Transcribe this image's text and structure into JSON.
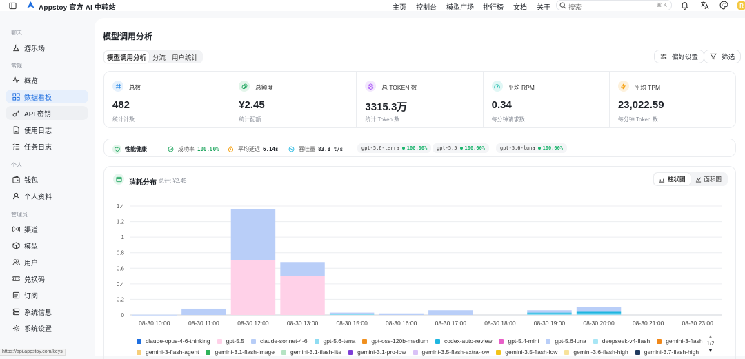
{
  "header": {
    "brand": "Appstoy 官方 AI 中转站",
    "nav": [
      "主页",
      "控制台",
      "模型广场",
      "排行榜",
      "文档",
      "关于"
    ],
    "search_placeholder": "搜索",
    "search_shortcut": "⌘ K",
    "avatar_initial": "R"
  },
  "sidebar": {
    "sections": [
      {
        "title": "聊天",
        "items": [
          {
            "label": "游乐场",
            "icon": "flask-icon"
          }
        ]
      },
      {
        "title": "常规",
        "items": [
          {
            "label": "概览",
            "icon": "activity-icon"
          },
          {
            "label": "数据看板",
            "icon": "dashboard-icon",
            "active": true
          },
          {
            "label": "API 密钥",
            "icon": "key-icon"
          },
          {
            "label": "使用日志",
            "icon": "log-icon"
          },
          {
            "label": "任务日志",
            "icon": "task-icon"
          }
        ]
      },
      {
        "title": "个人",
        "items": [
          {
            "label": "钱包",
            "icon": "wallet-icon"
          },
          {
            "label": "个人资料",
            "icon": "user-icon"
          }
        ]
      },
      {
        "title": "管理员",
        "items": [
          {
            "label": "渠道",
            "icon": "channel-icon"
          },
          {
            "label": "模型",
            "icon": "cube-icon"
          },
          {
            "label": "用户",
            "icon": "users-icon"
          },
          {
            "label": "兑换码",
            "icon": "ticket-icon"
          },
          {
            "label": "订阅",
            "icon": "subscription-icon"
          },
          {
            "label": "系统信息",
            "icon": "server-icon"
          },
          {
            "label": "系统设置",
            "icon": "settings-icon"
          }
        ]
      }
    ]
  },
  "status_url": "https://api.appstoy.com/keys",
  "page": {
    "title": "模型调用分析",
    "tabs": [
      "模型调用分析",
      "分流",
      "用户统计"
    ],
    "pref_button": "偏好设置",
    "filter_button": "筛选"
  },
  "stats": [
    {
      "label": "总数",
      "value": "482",
      "sub": "统计计数",
      "color": "#2b8ae6",
      "bg": "#e6f1fc"
    },
    {
      "label": "总额度",
      "value": "¥2.45",
      "sub": "统计配额",
      "color": "#19a35a",
      "bg": "#e3f5ea"
    },
    {
      "label": "总 TOKEN 数",
      "value": "3315.3万",
      "sub": "统计 Token 数",
      "color": "#a855f7",
      "bg": "#f3e8fd"
    },
    {
      "label": "平均 RPM",
      "value": "0.34",
      "sub": "每分钟请求数",
      "color": "#14b8a6",
      "bg": "#e0f7f5"
    },
    {
      "label": "平均 TPM",
      "value": "23,022.59",
      "sub": "每分钟 Token 数",
      "color": "#f59e0b",
      "bg": "#fdf1dc"
    }
  ],
  "health": {
    "title": "性能健康",
    "success_label": "成功率",
    "success_value": "100.00%",
    "latency_label": "平均延迟",
    "latency_value": "6.14s",
    "throughput_label": "吞吐量",
    "throughput_value": "83.8 t/s",
    "models": [
      {
        "name": "gpt-5.6-terra",
        "pct": "100.00%"
      },
      {
        "name": "gpt-5.5",
        "pct": "100.00%"
      },
      {
        "name": "gpt-5.6-luna",
        "pct": "100.00%"
      }
    ]
  },
  "chart_card": {
    "title": "消耗分布",
    "total": "总计: ¥2.45",
    "toggle": [
      "柱状图",
      "面积图"
    ],
    "pager": "1/2"
  },
  "chart_data": {
    "type": "bar",
    "stacked": true,
    "categories": [
      "08-30 10:00",
      "08-30 11:00",
      "08-30 12:00",
      "08-30 13:00",
      "08-30 15:00",
      "08-30 16:00",
      "08-30 17:00",
      "08-30 18:00",
      "08-30 19:00",
      "08-30 20:00",
      "08-30 21:00",
      "08-30 23:00"
    ],
    "yticks": [
      0,
      0.2,
      0.4,
      0.6,
      0.8,
      1,
      1.2,
      1.4
    ],
    "ylim": [
      0,
      1.4
    ],
    "grid": true,
    "series": [
      {
        "name": "claude-opus-4-6-thinking",
        "color": "#1f6fe0",
        "values": [
          0,
          0,
          0,
          0,
          0,
          0,
          0,
          0,
          0,
          0,
          0,
          0
        ]
      },
      {
        "name": "gpt-5.5",
        "color": "#ffd1e8",
        "values": [
          0,
          0,
          0.7,
          0.5,
          0,
          0,
          0,
          0,
          0,
          0,
          0,
          0
        ]
      },
      {
        "name": "claude-sonnet-4-6",
        "color": "#b7cdf7",
        "values": [
          0,
          0,
          0,
          0,
          0,
          0,
          0,
          0,
          0,
          0,
          0,
          0
        ]
      },
      {
        "name": "gpt-5.6-terra",
        "color": "#8fdcf2",
        "values": [
          0,
          0,
          0,
          0,
          0.01,
          0,
          0,
          0,
          0.02,
          0.02,
          0,
          0
        ]
      },
      {
        "name": "gpt-oss-120b-medium",
        "color": "#f0901f",
        "values": [
          0,
          0,
          0,
          0,
          0,
          0,
          0,
          0,
          0,
          0,
          0,
          0
        ]
      },
      {
        "name": "codex-auto-review",
        "color": "#1fb6e0",
        "values": [
          0,
          0,
          0,
          0,
          0,
          0,
          0,
          0,
          0.01,
          0.02,
          0,
          0
        ]
      },
      {
        "name": "gpt-5.4-mini",
        "color": "#e85fc8",
        "values": [
          0,
          0,
          0,
          0,
          0,
          0,
          0,
          0,
          0,
          0,
          0,
          0
        ]
      },
      {
        "name": "gpt-5.6-luna",
        "color": "#b9cef8",
        "values": [
          0.003,
          0.08,
          0.66,
          0.18,
          0.02,
          0.02,
          0.06,
          0,
          0.03,
          0.06,
          0,
          0
        ]
      },
      {
        "name": "deepseek-v4-flash",
        "color": "#a8e6f5",
        "values": [
          0,
          0,
          0,
          0,
          0,
          0,
          0,
          0,
          0,
          0,
          0,
          0
        ]
      },
      {
        "name": "gemini-3-flash",
        "color": "#f0881a",
        "values": [
          0,
          0,
          0,
          0,
          0,
          0,
          0,
          0,
          0,
          0,
          0,
          0
        ]
      },
      {
        "name": "gemini-3-flash-agent",
        "color": "#f7cf7a",
        "values": [
          0,
          0,
          0,
          0,
          0,
          0,
          0,
          0,
          0,
          0,
          0,
          0
        ]
      },
      {
        "name": "gemini-3.1-flash-image",
        "color": "#2fb35a",
        "values": [
          0,
          0,
          0,
          0,
          0,
          0,
          0,
          0,
          0,
          0,
          0,
          0
        ]
      },
      {
        "name": "gemini-3.1-flash-lite",
        "color": "#b5e3c3",
        "values": [
          0,
          0,
          0,
          0,
          0,
          0,
          0,
          0,
          0,
          0,
          0,
          0
        ]
      },
      {
        "name": "gemini-3.1-pro-low",
        "color": "#7d3fd6",
        "values": [
          0,
          0,
          0,
          0,
          0,
          0,
          0,
          0,
          0,
          0,
          0,
          0
        ]
      },
      {
        "name": "gemini-3.5-flash-extra-low",
        "color": "#d9c2f7",
        "values": [
          0,
          0,
          0,
          0,
          0,
          0,
          0,
          0,
          0,
          0,
          0,
          0
        ]
      },
      {
        "name": "gemini-3.5-flash-low",
        "color": "#f2c318",
        "values": [
          0,
          0,
          0,
          0,
          0,
          0,
          0,
          0,
          0,
          0,
          0,
          0
        ]
      },
      {
        "name": "gemini-3.6-flash-high",
        "color": "#f7e29a",
        "values": [
          0,
          0,
          0,
          0,
          0,
          0,
          0,
          0,
          0,
          0,
          0,
          0
        ]
      },
      {
        "name": "gemini-3.7-flash-high",
        "color": "#1f3a5f",
        "values": [
          0,
          0,
          0,
          0,
          0,
          0,
          0,
          0,
          0,
          0,
          0,
          0
        ]
      }
    ]
  }
}
